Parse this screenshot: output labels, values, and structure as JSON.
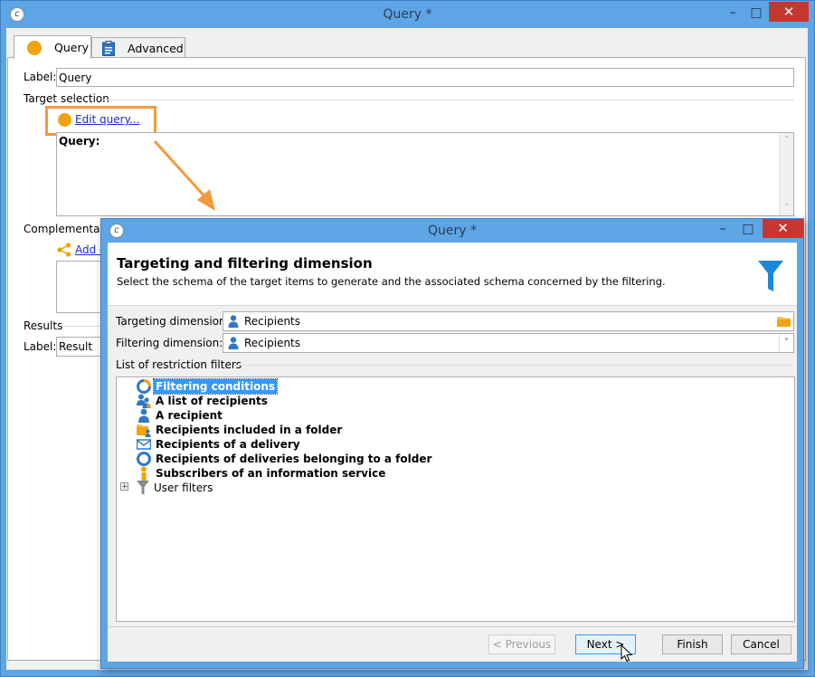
{
  "outer_window": {
    "title": "Query *",
    "app_icon_glyph": "c",
    "tabs": [
      {
        "label": "Query",
        "icon": "orange-circle-icon"
      },
      {
        "label": "Advanced",
        "icon": "clipboard-icon"
      }
    ],
    "label_caption": "Label:",
    "label_value": "Query",
    "target_selection_title": "Target selection",
    "edit_query_link": "Edit query...",
    "query_box_text": "Query:",
    "complementary_title": "Complementary",
    "add_link": "Add d",
    "results_title": "Results",
    "result_label_caption": "Label:",
    "result_label_value": "Result"
  },
  "inner_dialog": {
    "title": "Query *",
    "app_icon_glyph": "c",
    "header_title": "Targeting and filtering dimension",
    "header_description": "Select the schema of the target items to  generate and the associated schema concerned by the filtering.",
    "header_icon": "funnel-icon",
    "targeting_dimension_label": "Targeting dimension:",
    "targeting_dimension_value": "Recipients",
    "filtering_dimension_label": "Filtering dimension:",
    "filtering_dimension_value": "Recipients",
    "restriction_filters_title": "List of restriction filters",
    "filters": [
      {
        "label": "Filtering conditions",
        "icon": "filtering-conditions-icon",
        "selected": true
      },
      {
        "label": "A list of recipients",
        "icon": "recipient-list-icon",
        "selected": false
      },
      {
        "label": "A recipient",
        "icon": "recipient-icon",
        "selected": false
      },
      {
        "label": "Recipients included in a folder",
        "icon": "folder-recipients-icon",
        "selected": false
      },
      {
        "label": "Recipients of a delivery",
        "icon": "delivery-envelope-icon",
        "selected": false
      },
      {
        "label": "Recipients of deliveries belonging to a folder",
        "icon": "delivery-folder-icon",
        "selected": false
      },
      {
        "label": "Subscribers of an information service",
        "icon": "subscriber-icon",
        "selected": false
      },
      {
        "label": "User filters",
        "icon": "user-filters-funnel-icon",
        "selected": false,
        "expandable": true
      }
    ],
    "buttons": {
      "previous": "< Previous",
      "next": "Next >",
      "finish": "Finish",
      "cancel": "Cancel"
    }
  },
  "colors": {
    "accent_orange": "#f0a30a",
    "highlight_orange": "#f19a3e",
    "title_bar_blue": "#5ea5e6",
    "close_red": "#c7372f",
    "selection_blue": "#3399ff",
    "funnel_blue": "#1e88d8"
  }
}
